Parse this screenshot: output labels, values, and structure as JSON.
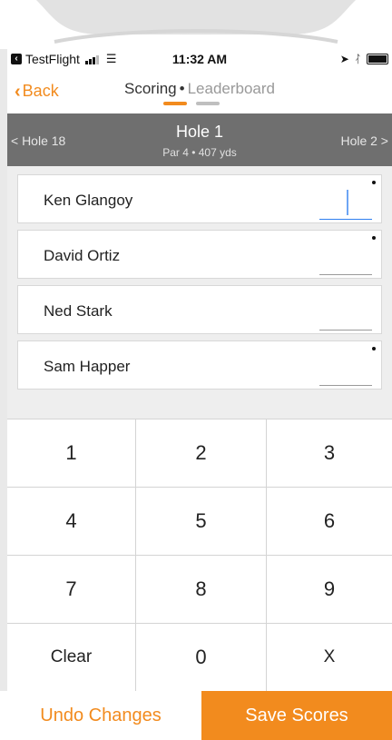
{
  "status_bar": {
    "app_badge": "TestFlight",
    "time": "11:32 AM"
  },
  "nav": {
    "back_label": "Back",
    "segments": {
      "active": "Scoring",
      "separator": "•",
      "inactive": "Leaderboard"
    }
  },
  "hole": {
    "prev_label": "< Hole 18",
    "title": "Hole 1",
    "subtitle": "Par 4 • 407 yds",
    "next_label": "Hole 2 >"
  },
  "players": [
    {
      "name": "Ken Glangoy",
      "score": ""
    },
    {
      "name": "David Ortiz",
      "score": ""
    },
    {
      "name": "Ned Stark",
      "score": ""
    },
    {
      "name": "Sam Happer",
      "score": ""
    }
  ],
  "keypad": [
    "1",
    "2",
    "3",
    "4",
    "5",
    "6",
    "7",
    "8",
    "9",
    "Clear",
    "0",
    "X"
  ],
  "actions": {
    "undo_label": "Undo Changes",
    "save_label": "Save Scores"
  },
  "colors": {
    "accent": "#f28b1e",
    "header_bg": "#6f6f6f",
    "focus": "#2f7ff0"
  }
}
